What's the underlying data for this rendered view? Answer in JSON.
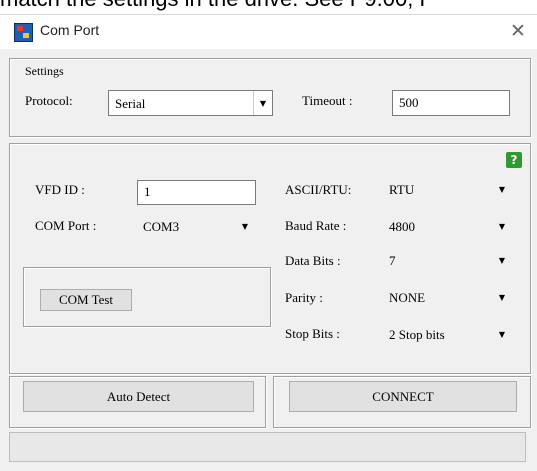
{
  "background_text": "match the settings in the drive.  See P9.00, P",
  "window": {
    "title": "Com Port",
    "close_glyph": "✕"
  },
  "settings": {
    "group_label": "Settings",
    "protocol_label": "Protocol:",
    "protocol_value": "Serial",
    "timeout_label": "Timeout :",
    "timeout_value": "500"
  },
  "comm": {
    "vfd_id_label": "VFD ID :",
    "vfd_id_value": "1",
    "com_port_label": "COM Port :",
    "com_port_value": "COM3",
    "com_test_label": "COM Test",
    "ascii_rtu_label": "ASCII/RTU:",
    "ascii_rtu_value": "RTU",
    "baud_rate_label": "Baud Rate :",
    "baud_rate_value": "4800",
    "data_bits_label": "Data Bits :",
    "data_bits_value": "7",
    "parity_label": "Parity :",
    "parity_value": "NONE",
    "stop_bits_label": "Stop Bits :",
    "stop_bits_value": "2 Stop bits",
    "help_glyph": "?"
  },
  "actions": {
    "auto_detect_label": "Auto Detect",
    "connect_label": "CONNECT"
  },
  "icons": {
    "app": "app-icon",
    "close": "close-icon",
    "help": "help-icon",
    "dropdown": "dropdown-arrow-icon"
  },
  "colors": {
    "help_icon": "#2f9a2f",
    "window_bg": "#f0f0f0"
  }
}
